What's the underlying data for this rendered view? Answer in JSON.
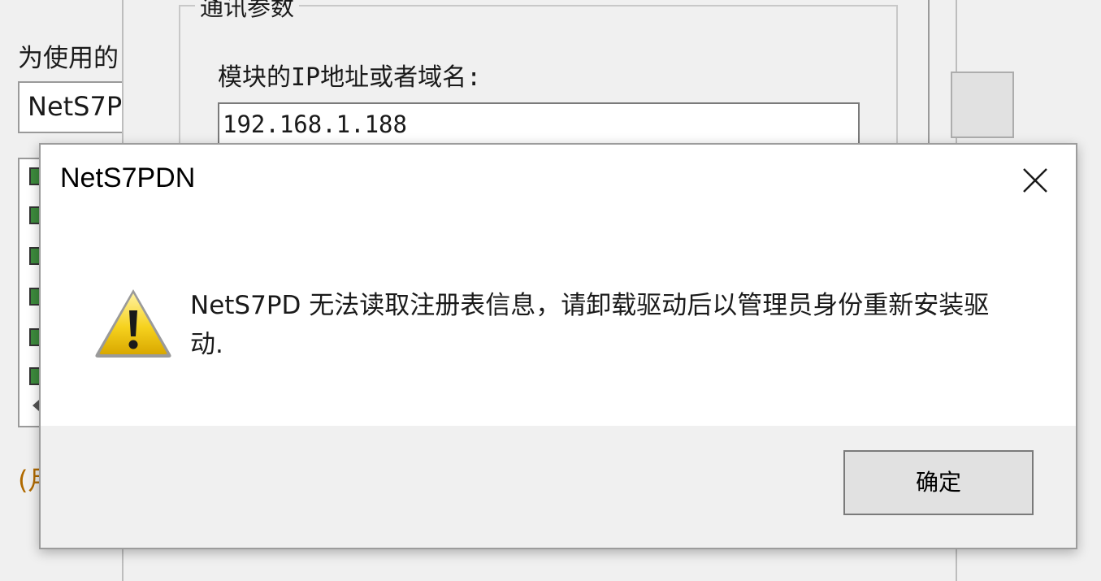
{
  "background_window": {
    "label_partial": "为使用的",
    "field_value_partial": "NetS7P",
    "note_partial": "(月"
  },
  "background_dialog": {
    "group_title": "通讯参数",
    "ip_label": "模块的IP地址或者域名:",
    "ip_value": "192.168.1.188"
  },
  "message_box": {
    "title": "NetS7PDN",
    "close_icon": "close-icon",
    "message_icon": "warning-icon",
    "message_text": "NetS7PD  无法读取注册表信息，请卸载驱动后以管理员身份重新安装驱动.",
    "ok_label": "确定"
  },
  "colors": {
    "warning_yellow": "#f6d21e",
    "dialog_footer": "#f0f0f0",
    "window_bg": "#ffffff"
  }
}
